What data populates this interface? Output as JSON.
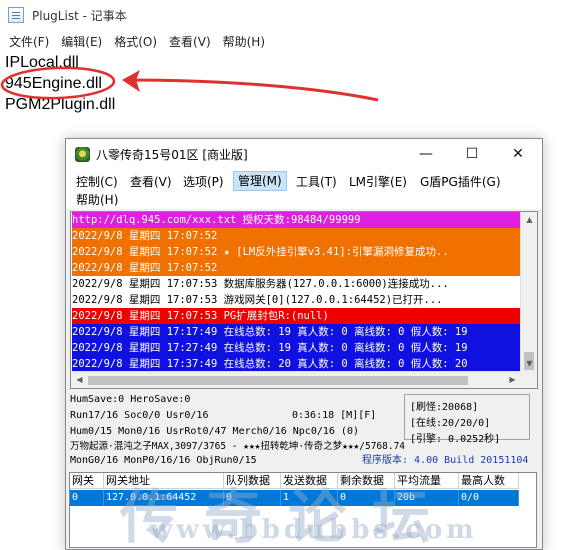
{
  "notepad": {
    "title": "PlugList - 记事本",
    "menu": [
      "文件(F)",
      "编辑(E)",
      "格式(O)",
      "查看(V)",
      "帮助(H)"
    ],
    "lines": [
      "IPLocal.dll",
      "945Engine.dll",
      "PGM2Plugin.dll"
    ]
  },
  "app": {
    "title": "八零传奇15号01区 [商业版]",
    "controls": {
      "minimize": "—",
      "maximize": "☐",
      "close": "✕"
    },
    "menu": [
      "控制(C)",
      "查看(V)",
      "选项(P)",
      "管理(M)",
      "工具(T)",
      "LM引擎(E)",
      "G盾PG插件(G)",
      "帮助(H)"
    ],
    "active_menu": "管理(M)",
    "log": [
      {
        "text": "http://dlq.945.com/xxx.txt 授权天数:98484/99999",
        "fg": "#ffffff",
        "bg": "#e020e0"
      },
      {
        "text": "2022/9/8 星期四 17:07:52",
        "fg": "#ffffff",
        "bg": "#f07000"
      },
      {
        "text": "2022/9/8 星期四 17:07:52 ★ [LM反外挂引擎v3.41]:引擎漏洞修复成功..",
        "fg": "#ffffff",
        "bg": "#f07000"
      },
      {
        "text": "2022/9/8 星期四 17:07:52",
        "fg": "#ffffff",
        "bg": "#f07000"
      },
      {
        "text": "2022/9/8 星期四 17:07:53 数据库服务器(127.0.0.1:6000)连接成功...",
        "fg": "#000000",
        "bg": "#ffffff"
      },
      {
        "text": "2022/9/8 星期四 17:07:53 游戏网关[0](127.0.0.1:64452)已打开...",
        "fg": "#000000",
        "bg": "#ffffff"
      },
      {
        "text": "2022/9/8 星期四 17:07:53 PG扩展封包R:(null)",
        "fg": "#ffffff",
        "bg": "#ee0000"
      },
      {
        "text": "2022/9/8 星期四 17:17:49 在线总数: 19 真人数: 0 离线数: 0 假人数: 19",
        "fg": "#ffffff",
        "bg": "#1010e0"
      },
      {
        "text": "2022/9/8 星期四 17:27:49 在线总数: 19 真人数: 0 离线数: 0 假人数: 19",
        "fg": "#ffffff",
        "bg": "#1010e0"
      },
      {
        "text": "2022/9/8 星期四 17:37:49 在线总数: 20 真人数: 0 离线数: 0 假人数: 20",
        "fg": "#ffffff",
        "bg": "#1010e0"
      }
    ],
    "status": {
      "line1": "HumSave:0 HeroSave:0",
      "line2": "Run17/16 Soc0/0 Usr0/16",
      "clock": "0:36:18 [M][F]",
      "line3": "Hum0/15 Mon0/16 UsrRot0/47 Merch0/16 Npc0/16 (0)",
      "line4": "万物起源·混沌之子MAX,3097/3765 - ★★★扭转乾坤·传奇之梦★★★/5768.74",
      "line5": "MonG0/16 MonP0/16/16 ObjRun0/15",
      "refresh": "[刷怪:20068]",
      "online": "[在线:20/20/0]",
      "engine": "[引擎: 0.0252秒]",
      "version": "程序版本: 4.00 Build 20151104"
    },
    "table": {
      "headers": [
        "网关",
        "网关地址",
        "队列数据",
        "发送数据",
        "剩余数据",
        "平均流量",
        "最高人数"
      ],
      "rows": [
        [
          "0",
          "127.0.0.1:64452",
          "0",
          "1",
          "0",
          "20b",
          "0/0"
        ]
      ]
    }
  },
  "watermark": {
    "big": "传奇论坛",
    "url": "www.bbdubbs.com"
  },
  "colors": {
    "annotation": "#e03030",
    "selection": "#0078d7"
  }
}
